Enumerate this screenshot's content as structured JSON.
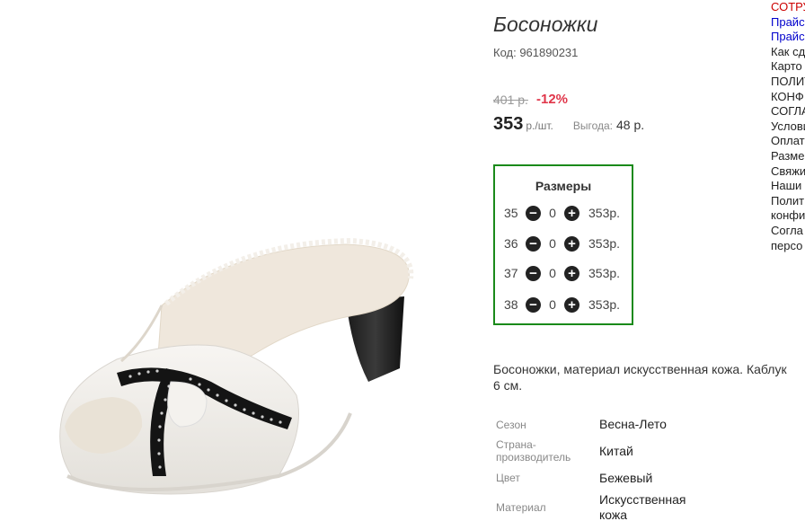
{
  "product": {
    "title": "Босоножки",
    "code": "Код: 961890231",
    "old_price": "401 р.",
    "discount": "-12%",
    "price": "353",
    "price_unit": "р./шт.",
    "benefit_label": "Выгода:",
    "benefit_value": "48 р."
  },
  "sizes": {
    "title": "Размеры",
    "rows": [
      {
        "size": "35",
        "qty": "0",
        "price": "353р."
      },
      {
        "size": "36",
        "qty": "0",
        "price": "353р."
      },
      {
        "size": "37",
        "qty": "0",
        "price": "353р."
      },
      {
        "size": "38",
        "qty": "0",
        "price": "353р."
      }
    ],
    "minus_icon": "minus-circle-icon",
    "plus_icon": "plus-circle-icon"
  },
  "description": "Босоножки, материал искусственная кожа. Каблук 6 см.",
  "specs": [
    {
      "key": "Сезон",
      "value": "Весна-Лето"
    },
    {
      "key": "Страна-производитель",
      "value": "Китай"
    },
    {
      "key": "Цвет",
      "value": "Бежевый"
    },
    {
      "key": "Материал",
      "value": "Искусственная кожа"
    }
  ],
  "sidebar": [
    "СОТРУ",
    "Прайс",
    "Прайс",
    "Как сд",
    "Карто",
    "ПОЛИТ",
    "КОНФ",
    "СОГЛА",
    "Услови",
    "Оплат",
    "Разме",
    "Свяжи",
    "Наши",
    "Полит",
    "конфи",
    "Согла",
    "персо"
  ],
  "colors": {
    "accent_red": "#e0364a",
    "sizes_border": "#1a8a1a",
    "link_blue": "#0000cc",
    "sidebar_red": "#cc0000"
  }
}
